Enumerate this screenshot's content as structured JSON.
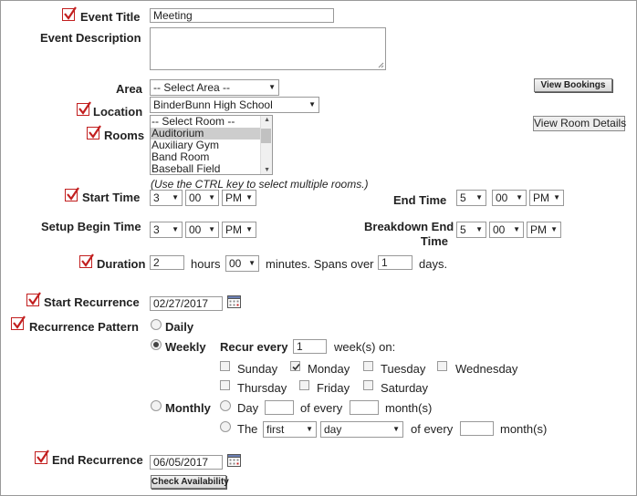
{
  "form": {
    "event_title": {
      "label": "Event Title",
      "value": "Meeting"
    },
    "event_description": {
      "label": "Event Description",
      "value": ""
    },
    "area": {
      "label": "Area",
      "selected": "-- Select Area --"
    },
    "view_bookings": "View Bookings",
    "location": {
      "label": "Location",
      "selected": "BinderBunn High School"
    },
    "rooms": {
      "label": "Rooms",
      "options": [
        "-- Select Room --",
        "Auditorium",
        "Auxiliary Gym",
        "Band Room",
        "Baseball Field"
      ],
      "hint": "(Use the CTRL key to select multiple rooms.)"
    },
    "view_room_details": "View Room Details",
    "start_time": {
      "label": "Start Time",
      "hour": "3",
      "minute": "00",
      "ampm": "PM"
    },
    "end_time": {
      "label": "End Time",
      "hour": "5",
      "minute": "00",
      "ampm": "PM"
    },
    "setup_begin_time": {
      "label": "Setup Begin Time",
      "hour": "3",
      "minute": "00",
      "ampm": "PM"
    },
    "breakdown_end_time": {
      "label_line1": "Breakdown End",
      "label_line2": "Time",
      "hour": "5",
      "minute": "00",
      "ampm": "PM"
    },
    "duration": {
      "label": "Duration",
      "hours": "2",
      "hours_text": "hours",
      "minutes": "00",
      "minutes_text": "minutes. Spans over",
      "days": "1",
      "days_text": "days."
    },
    "start_recurrence": {
      "label": "Start Recurrence",
      "value": "02/27/2017"
    },
    "recurrence_pattern": {
      "label": "Recurrence Pattern",
      "daily": "Daily",
      "weekly": "Weekly",
      "recur_every_label": "Recur every",
      "recur_every_value": "1",
      "weeks_on": "week(s) on:",
      "days": {
        "sunday": "Sunday",
        "monday": "Monday",
        "tuesday": "Tuesday",
        "wednesday": "Wednesday",
        "thursday": "Thursday",
        "friday": "Friday",
        "saturday": "Saturday"
      },
      "monthly": "Monthly",
      "day_label": "Day",
      "of_every": "of every",
      "months": "month(s)",
      "the_label": "The",
      "the_ordinal": "first",
      "the_unit": "day"
    },
    "end_recurrence": {
      "label": "End Recurrence",
      "value": "06/05/2017"
    },
    "check_availability": "Check Availability"
  },
  "colors": {
    "required_check": "#c21f1f"
  }
}
